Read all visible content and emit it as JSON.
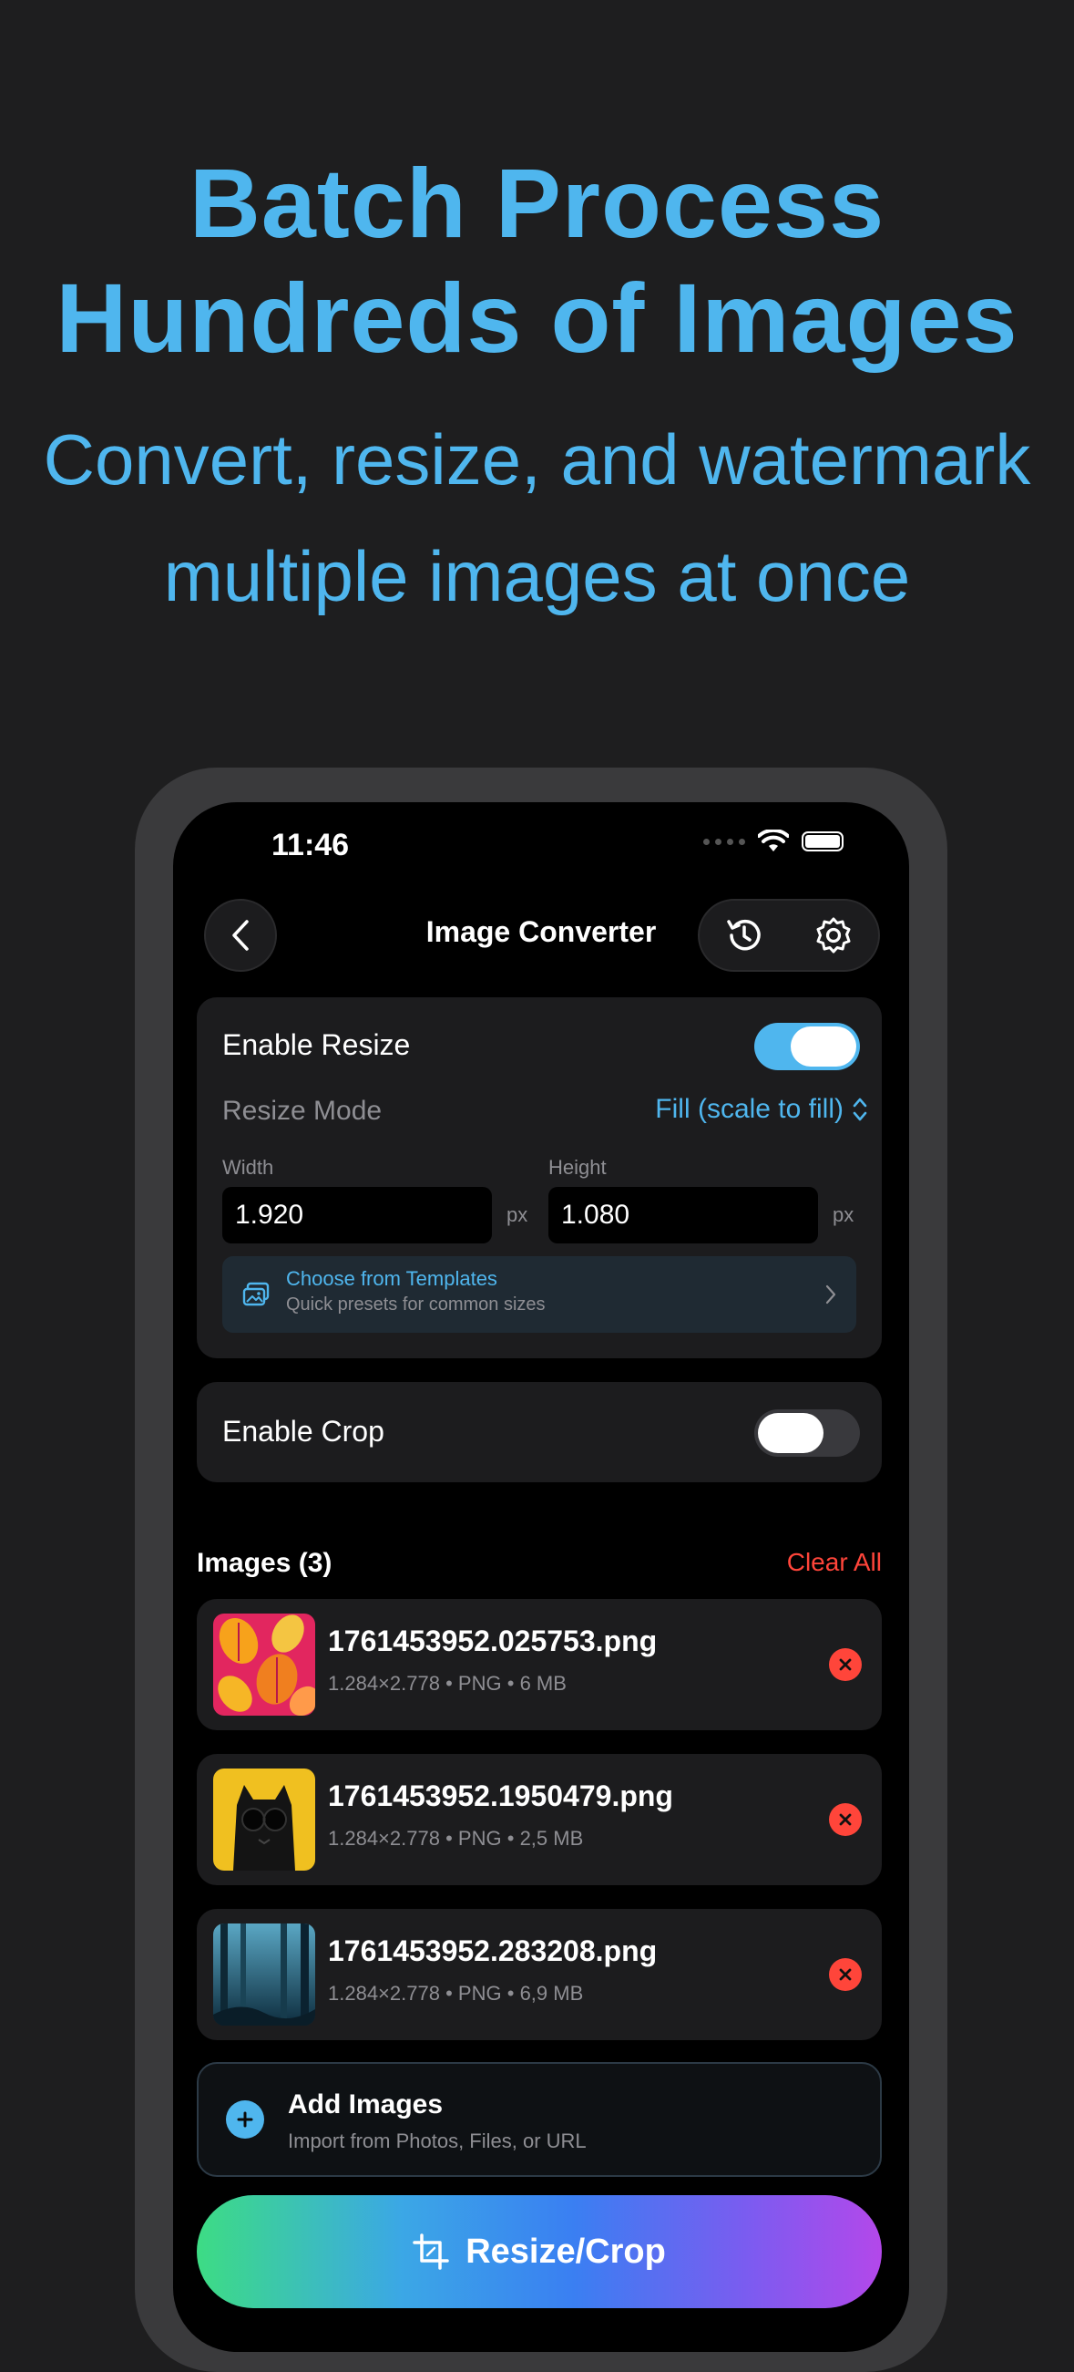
{
  "hero": {
    "title_line1": "Batch Process",
    "title_line2": "Hundreds of Images",
    "subtitle_line1": "Convert, resize, and watermark",
    "subtitle_line2": "multiple images at once"
  },
  "status_bar": {
    "time": "11:46"
  },
  "nav": {
    "title": "Image Converter",
    "icons": [
      "chevron-left-icon",
      "history-icon",
      "gear-icon"
    ]
  },
  "resize": {
    "enable_label": "Enable Resize",
    "enabled": true,
    "mode_label": "Resize Mode",
    "mode_value": "Fill (scale to fill)",
    "width_label": "Width",
    "width_value": "1.920",
    "height_label": "Height",
    "height_value": "1.080",
    "unit": "px",
    "templates_title": "Choose from Templates",
    "templates_subtitle": "Quick presets for common sizes"
  },
  "crop": {
    "enable_label": "Enable Crop",
    "enabled": false
  },
  "images": {
    "header": "Images (3)",
    "clear_all": "Clear All",
    "items": [
      {
        "name": "1761453952.025753.png",
        "dimensions": "1.284×2.778",
        "format": "PNG",
        "size": "6 MB"
      },
      {
        "name": "1761453952.1950479.png",
        "dimensions": "1.284×2.778",
        "format": "PNG",
        "size": "2,5 MB"
      },
      {
        "name": "1761453952.283208.png",
        "dimensions": "1.284×2.778",
        "format": "PNG",
        "size": "6,9 MB"
      }
    ],
    "separator": "•"
  },
  "add_images": {
    "title": "Add Images",
    "subtitle": "Import from Photos, Files, or URL"
  },
  "primary_action": {
    "label": "Resize/Crop"
  },
  "colors": {
    "accent": "#4fb6ee",
    "danger": "#ff453a",
    "background": "#1e1e1f"
  }
}
